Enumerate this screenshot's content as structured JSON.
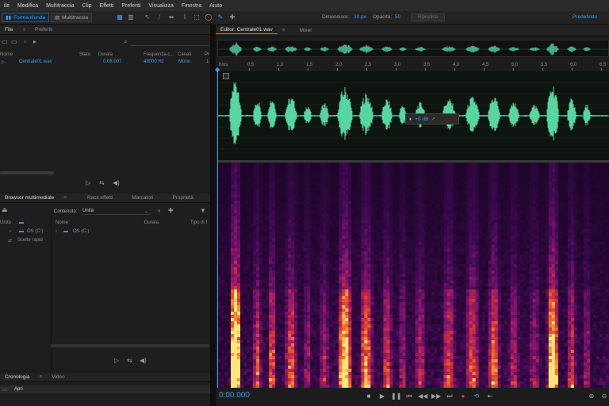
{
  "menu": [
    "ile",
    "Modifica",
    "Multitraccia",
    "Clip",
    "Effetti",
    "Preferiti",
    "Visualizza",
    "Finestra",
    "Aiuto"
  ],
  "toolbar": {
    "waveform_label": "Forma d'onda",
    "multitrack_label": "Multitraccia",
    "dimensions_label": "Dimensioni:",
    "dimensions_value": "30 px",
    "opacity_label": "Opacità:",
    "opacity_value": "50",
    "reset_label": "Ripristina",
    "workspace_label": "Predefinito"
  },
  "files_panel": {
    "tabs": [
      "File",
      "Preferiti"
    ],
    "columns": [
      "Nome",
      "Stato",
      "Durata",
      "Frequenza c...",
      "Canali",
      "Pr"
    ],
    "rows": [
      {
        "name": "Centrale01.wav",
        "status": "",
        "duration": "0:08.007",
        "rate": "48000 Hz",
        "channels": "Mono",
        "extra": "1"
      }
    ]
  },
  "media_panel": {
    "tabs": [
      "Browser multimediale",
      "Rack effetti",
      "Marcatori",
      "Proprietà"
    ],
    "content_label": "Contenuto:",
    "content_value": "Unità",
    "tree": [
      {
        "label": "Unità",
        "level": 0
      },
      {
        "label": "OS (C:)",
        "level": 1
      },
      {
        "label": "Scelte rapid",
        "level": 0
      }
    ],
    "columns": [
      "Nome",
      "Durata",
      "Tipo di f"
    ],
    "list": [
      {
        "label": "OS (C:)"
      }
    ]
  },
  "history_panel": {
    "tabs": [
      "Cronologia",
      "Video"
    ],
    "items": [
      "Apri"
    ]
  },
  "editor": {
    "tabs": [
      "Editor: Centrale01.wav",
      "Mixer"
    ],
    "ruler_unit": "hms",
    "ruler_ticks": [
      "0,5",
      "1,0",
      "1,5",
      "2,0",
      "2,5",
      "3,0",
      "3,5",
      "4,0",
      "4,5",
      "5,0",
      "5,5",
      "6,0",
      "6,5"
    ],
    "hud_db": "+0 dB",
    "timecode": "0:00.000"
  },
  "colors": {
    "accent": "#3a9df0",
    "waveform": "#56d6a0",
    "background": "#1b1b1b"
  }
}
